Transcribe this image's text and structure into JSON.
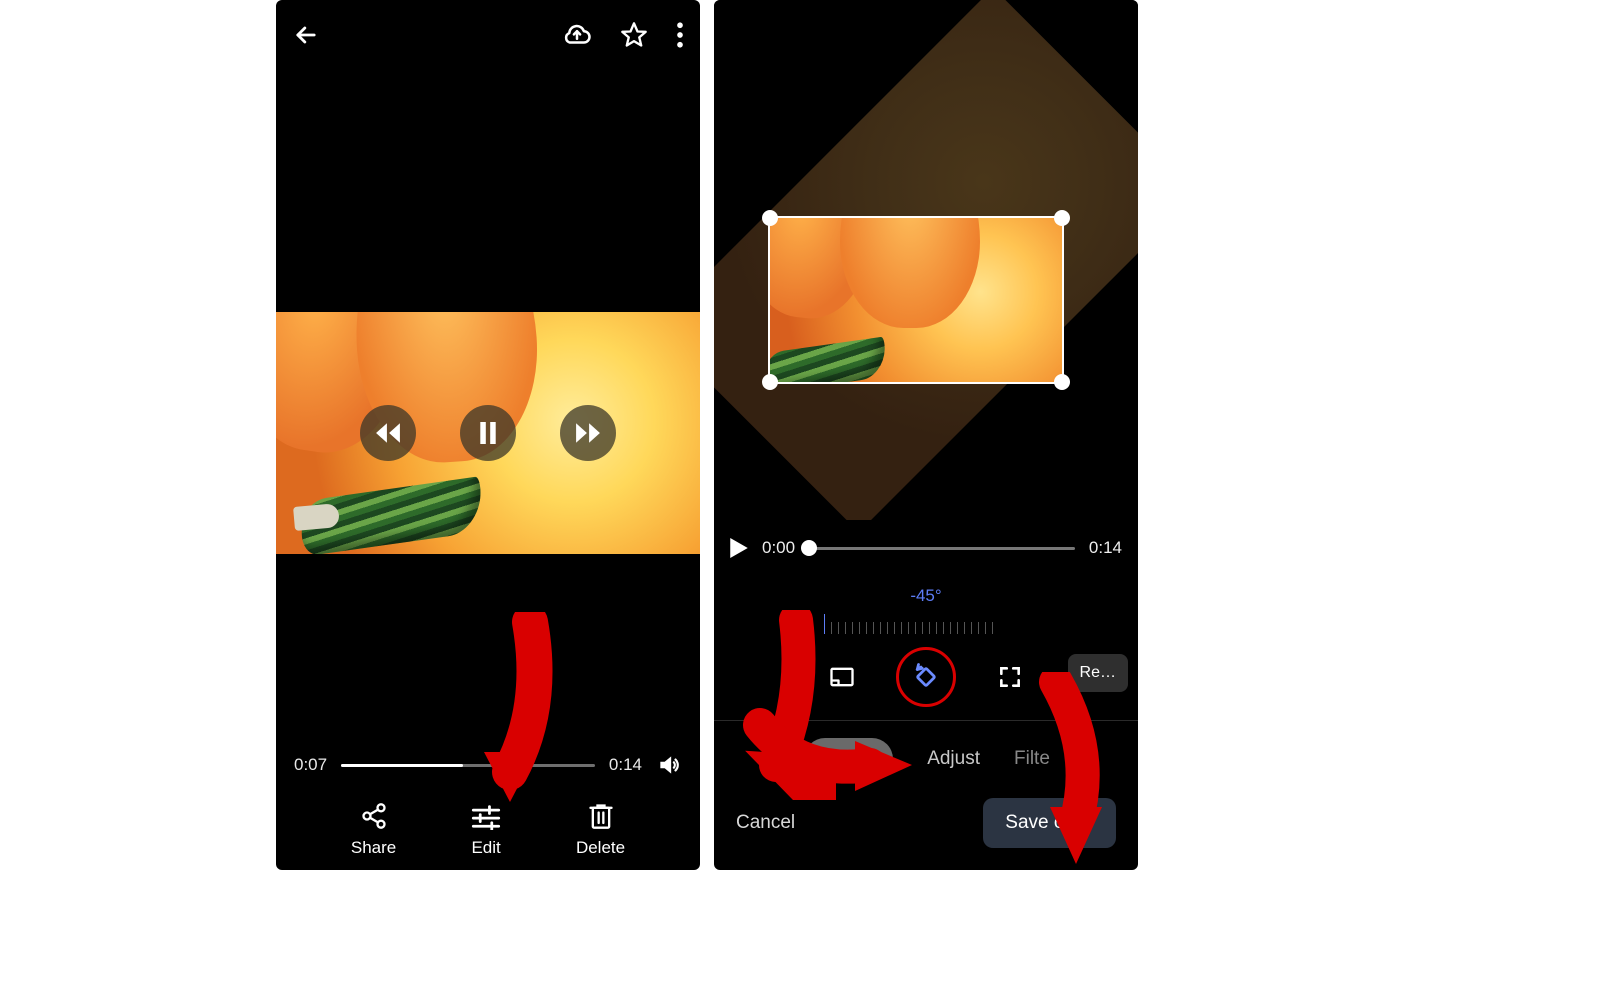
{
  "left": {
    "playback": {
      "current": "0:07",
      "duration": "0:14",
      "progress_pct": 48
    },
    "actions": {
      "share": "Share",
      "edit": "Edit",
      "delete": "Delete"
    }
  },
  "right": {
    "playback": {
      "current": "0:00",
      "duration": "0:14",
      "progress_pct": 0
    },
    "rotation_label": "-45°",
    "reset_label": "Re…",
    "tabs": {
      "crop": "Crop",
      "adjust": "Adjust",
      "filters_cut": "Filte"
    },
    "cancel": "Cancel",
    "save": "Save copy"
  }
}
